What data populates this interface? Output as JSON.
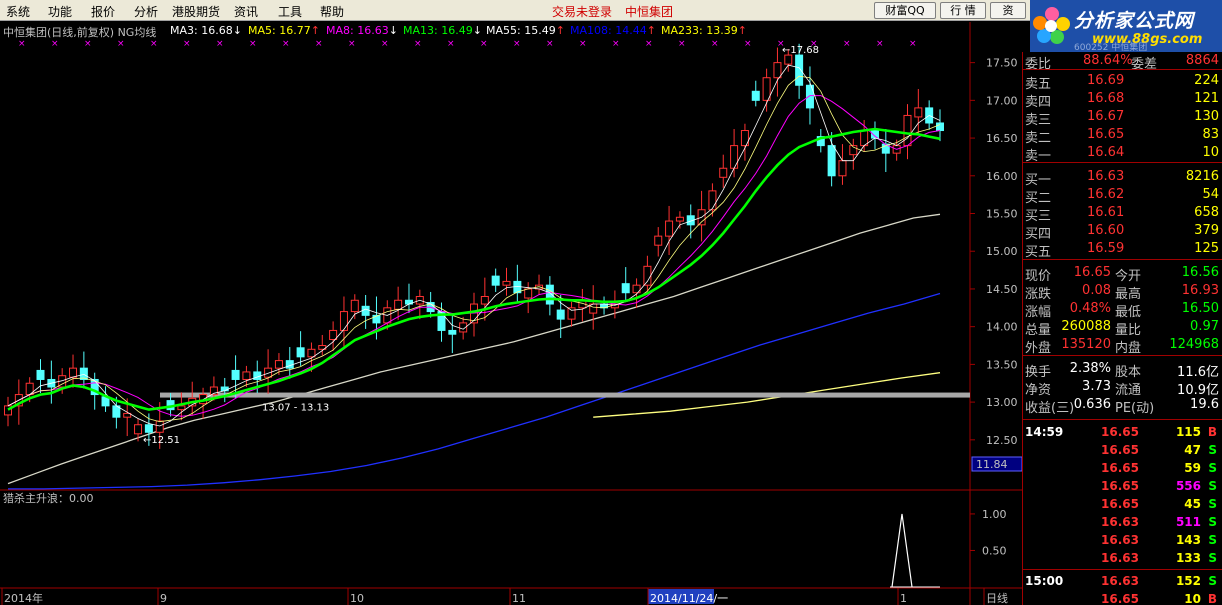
{
  "menu": [
    "系统",
    "功能",
    "报价",
    "分析",
    "港股期货",
    "资讯",
    "工具",
    "帮助"
  ],
  "status_login": "交易未登录",
  "status_stock": "中恒集团",
  "buttons": [
    "财富QQ",
    "行 情",
    "资"
  ],
  "logo": {
    "name": "分析家公式网",
    "url": "www.88gs.com",
    "code": "600252 中恒集团"
  },
  "chart_title": "中恒集团(日线,前复权) NG均线",
  "ma_labels": [
    {
      "text": "MA3: 16.68",
      "arrow": "↓",
      "color": "#ffffff"
    },
    {
      "text": "MA5: 16.77",
      "arrow": "↑",
      "color": "#ffff00"
    },
    {
      "text": "MA8: 16.63",
      "arrow": "↓",
      "color": "#ff00ff"
    },
    {
      "text": "MA13: 16.49",
      "arrow": "↓",
      "color": "#00ff00"
    },
    {
      "text": "MA55: 15.49",
      "arrow": "↑",
      "color": "#ffffff"
    },
    {
      "text": "MA108: 14.44",
      "arrow": "↑",
      "color": "#0000ff"
    },
    {
      "text": "MA233: 13.39",
      "arrow": "↑",
      "color": "#ffff00"
    }
  ],
  "colors": {
    "up": "#ff3232",
    "down": "#54ffff",
    "border": "#a00000",
    "text": "#c0c0c0",
    "ma_green": "#00ff00"
  },
  "chart_data": {
    "type": "candlestick",
    "ylim": [
      12.1,
      17.8
    ],
    "y_ticks": [
      "17.50",
      "17.00",
      "16.50",
      "16.00",
      "15.50",
      "15.00",
      "14.50",
      "14.00",
      "13.50",
      "13.00",
      "12.50"
    ],
    "y_tick_values": [
      17.5,
      17.0,
      16.5,
      16.0,
      15.5,
      15.0,
      14.5,
      14.0,
      13.5,
      13.0,
      12.5
    ],
    "x_labels": [
      "2014年",
      "9",
      "10",
      "11",
      "2014/11/24/一",
      "1",
      "日线"
    ],
    "annotations": [
      {
        "text": "17.68",
        "value": 17.68
      },
      {
        "text": "12.51",
        "value": 12.51
      },
      {
        "text": "13.07 - 13.13",
        "value": 13.1
      }
    ],
    "current_price_tag": "11.84",
    "closes": [
      12.95,
      13.1,
      13.25,
      13.3,
      13.2,
      13.35,
      13.45,
      13.3,
      13.1,
      12.95,
      12.8,
      12.85,
      12.7,
      12.6,
      12.75,
      12.9,
      12.95,
      13.05,
      13.1,
      13.2,
      13.15,
      13.3,
      13.4,
      13.3,
      13.45,
      13.55,
      13.45,
      13.6,
      13.7,
      13.75,
      13.95,
      14.2,
      14.35,
      14.15,
      14.05,
      14.25,
      14.35,
      14.3,
      14.4,
      14.2,
      13.95,
      13.9,
      14.05,
      14.3,
      14.4,
      14.55,
      14.6,
      14.45,
      14.5,
      14.55,
      14.3,
      14.1,
      14.25,
      14.35,
      14.3,
      14.25,
      14.3,
      14.45,
      14.55,
      14.8,
      15.2,
      15.4,
      15.45,
      15.35,
      15.55,
      15.8,
      16.1,
      16.4,
      16.6,
      17.0,
      17.3,
      17.5,
      17.6,
      17.2,
      16.9,
      16.4,
      16.0,
      16.2,
      16.4,
      16.6,
      16.5,
      16.3,
      16.4,
      16.8,
      16.9,
      16.7,
      16.6
    ],
    "ma13": [
      12.9,
      12.98,
      13.05,
      13.1,
      13.12,
      13.18,
      13.22,
      13.2,
      13.15,
      13.08,
      13.02,
      12.98,
      12.94,
      12.9,
      12.92,
      12.94,
      12.97,
      13.0,
      13.02,
      13.05,
      13.08,
      13.12,
      13.16,
      13.2,
      13.24,
      13.28,
      13.33,
      13.38,
      13.44,
      13.52,
      13.62,
      13.72,
      13.82,
      13.88,
      13.94,
      14.0,
      14.05,
      14.1,
      14.13,
      14.15,
      14.16,
      14.16,
      14.18,
      14.2,
      14.23,
      14.27,
      14.3,
      14.32,
      14.34,
      14.36,
      14.37,
      14.36,
      14.35,
      14.35,
      14.34,
      14.33,
      14.33,
      14.34,
      14.38,
      14.44,
      14.52,
      14.62,
      14.72,
      14.82,
      14.94,
      15.08,
      15.24,
      15.42,
      15.6,
      15.8,
      15.98,
      16.14,
      16.28,
      16.38,
      16.44,
      16.5,
      16.52,
      16.55,
      16.58,
      16.6,
      16.62,
      16.6,
      16.58,
      16.56,
      16.55,
      16.52,
      16.49
    ],
    "ma55": [
      11.92,
      12.05,
      12.18,
      12.3,
      12.42,
      12.54,
      12.66,
      12.76,
      12.84,
      12.92,
      13.0,
      13.1,
      13.2,
      13.3,
      13.4,
      13.48,
      13.56,
      13.64,
      13.72,
      13.8,
      13.9,
      14.0,
      14.1,
      14.2,
      14.3,
      14.4,
      14.52,
      14.64,
      14.76,
      14.88,
      15.0,
      15.12,
      15.24,
      15.34,
      15.44,
      15.49
    ],
    "ma108": [
      11.85,
      11.85,
      11.86,
      11.87,
      11.88,
      11.9,
      11.93,
      11.97,
      12.02,
      12.08,
      12.16,
      12.26,
      12.38,
      12.52,
      12.66,
      12.8,
      12.96,
      13.12,
      13.28,
      13.44,
      13.6,
      13.76,
      13.9,
      14.04,
      14.18,
      14.3,
      14.44
    ],
    "ma233": [
      12.8,
      12.84,
      12.88,
      12.94,
      13.0,
      13.08,
      13.16,
      13.24,
      13.32,
      13.39
    ],
    "indicator": {
      "label": "猎杀主升浪：0.00",
      "ylim": [
        0,
        1.3
      ],
      "y_ticks": [
        "1.00",
        "0.50"
      ],
      "spike_value": 1.0
    }
  },
  "quote": {
    "weibi_label": "委比",
    "weibi_value": "88.64%",
    "weicha_label": "委差",
    "weicha_value": "8864",
    "asks": [
      {
        "label": "卖五",
        "price": "16.69",
        "vol": "224"
      },
      {
        "label": "卖四",
        "price": "16.68",
        "vol": "121"
      },
      {
        "label": "卖三",
        "price": "16.67",
        "vol": "130"
      },
      {
        "label": "卖二",
        "price": "16.65",
        "vol": "83"
      },
      {
        "label": "卖一",
        "price": "16.64",
        "vol": "10"
      }
    ],
    "bids": [
      {
        "label": "买一",
        "price": "16.63",
        "vol": "8216"
      },
      {
        "label": "买二",
        "price": "16.62",
        "vol": "54"
      },
      {
        "label": "买三",
        "price": "16.61",
        "vol": "658"
      },
      {
        "label": "买四",
        "price": "16.60",
        "vol": "379"
      },
      {
        "label": "买五",
        "price": "16.59",
        "vol": "125"
      }
    ],
    "stats": [
      {
        "l1": "现价",
        "v1": "16.65",
        "c1": "#ff3232",
        "l2": "今开",
        "v2": "16.56",
        "c2": "#00ff00"
      },
      {
        "l1": "涨跌",
        "v1": "0.08",
        "c1": "#ff3232",
        "l2": "最高",
        "v2": "16.93",
        "c2": "#ff3232"
      },
      {
        "l1": "涨幅",
        "v1": "0.48%",
        "c1": "#ff3232",
        "l2": "最低",
        "v2": "16.50",
        "c2": "#00ff00"
      },
      {
        "l1": "总量",
        "v1": "260088",
        "c1": "#ffff00",
        "l2": "量比",
        "v2": "0.97",
        "c2": "#00ff00"
      },
      {
        "l1": "外盘",
        "v1": "135120",
        "c1": "#ff3232",
        "l2": "内盘",
        "v2": "124968",
        "c2": "#00ff00"
      }
    ],
    "stats2": [
      {
        "l1": "换手",
        "v1": "2.38%",
        "l2": "股本",
        "v2": "11.6亿"
      },
      {
        "l1": "净资",
        "v1": "3.73",
        "l2": "流通",
        "v2": "10.9亿"
      },
      {
        "l1": "收益(三)",
        "v1": "0.636",
        "l2": "PE(动)",
        "v2": "19.6"
      }
    ],
    "ticks": [
      {
        "time": "14:59",
        "price": "16.65",
        "vol": "115",
        "side": "B"
      },
      {
        "time": "",
        "price": "16.65",
        "vol": "47",
        "side": "S"
      },
      {
        "time": "",
        "price": "16.65",
        "vol": "59",
        "side": "S"
      },
      {
        "time": "",
        "price": "16.65",
        "vol": "556",
        "side": "S"
      },
      {
        "time": "",
        "price": "16.65",
        "vol": "45",
        "side": "S"
      },
      {
        "time": "",
        "price": "16.63",
        "vol": "511",
        "side": "S"
      },
      {
        "time": "",
        "price": "16.63",
        "vol": "143",
        "side": "S"
      },
      {
        "time": "",
        "price": "16.63",
        "vol": "133",
        "side": "S"
      },
      {
        "time": "15:00",
        "price": "16.63",
        "vol": "152",
        "side": "S"
      },
      {
        "time": "",
        "price": "16.65",
        "vol": "10",
        "side": "B"
      }
    ]
  }
}
